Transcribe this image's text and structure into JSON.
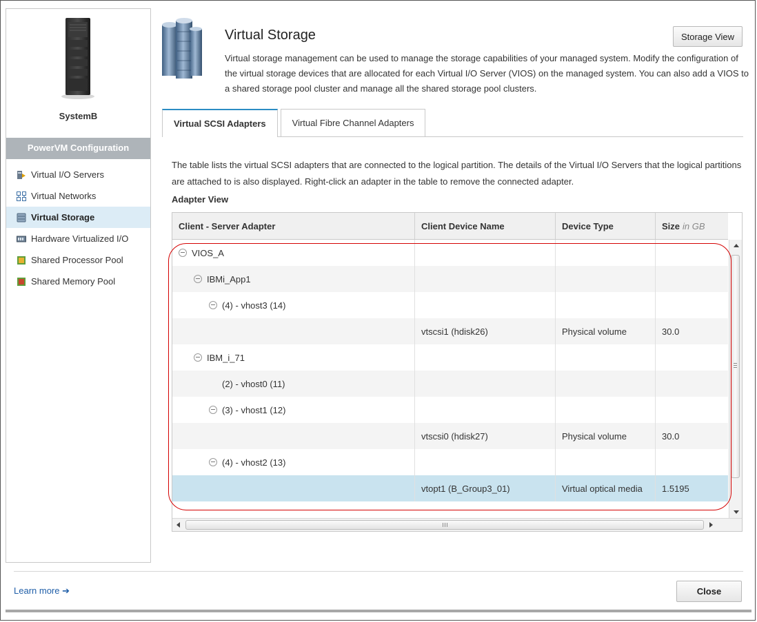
{
  "sidebar": {
    "system_name": "SystemB",
    "section_header": "PowerVM Configuration",
    "items": [
      {
        "label": "Virtual I/O Servers",
        "icon": "vios-icon",
        "active": false
      },
      {
        "label": "Virtual Networks",
        "icon": "network-icon",
        "active": false
      },
      {
        "label": "Virtual Storage",
        "icon": "storage-icon",
        "active": true
      },
      {
        "label": "Hardware Virtualized I/O",
        "icon": "hardware-io-icon",
        "active": false
      },
      {
        "label": "Shared Processor Pool",
        "icon": "processor-pool-icon",
        "active": false
      },
      {
        "label": "Shared Memory Pool",
        "icon": "memory-pool-icon",
        "active": false
      }
    ]
  },
  "header": {
    "title": "Virtual Storage",
    "storage_view_label": "Storage View",
    "description": "Virtual storage management can be used to manage the storage capabilities of your managed system. Modify the configuration of the virtual storage devices that are allocated for each Virtual I/O Server (VIOS) on the managed system. You can also add a VIOS to a shared storage pool cluster and manage all the shared storage pool clusters."
  },
  "tabs": [
    {
      "label": "Virtual SCSI Adapters",
      "active": true
    },
    {
      "label": "Virtual Fibre Channel Adapters",
      "active": false
    }
  ],
  "table": {
    "description": "The table lists the virtual SCSI adapters that are connected to the logical partition. The details of the Virtual I/O Servers that the logical partitions are attached to is also displayed. Right-click an adapter in the table to remove the connected adapter.",
    "section_label": "Adapter View",
    "columns": {
      "adapter": "Client - Server Adapter",
      "device_name": "Client Device Name",
      "device_type": "Device Type",
      "size": "Size",
      "size_unit": "in GB"
    },
    "rows": [
      {
        "adapter": "VIOS_A",
        "level": 0,
        "expander": true,
        "device_name": "",
        "device_type": "",
        "size": "",
        "selected": false
      },
      {
        "adapter": "IBMi_App1",
        "level": 1,
        "expander": true,
        "device_name": "",
        "device_type": "",
        "size": "",
        "selected": false
      },
      {
        "adapter": "(4) - vhost3 (14)",
        "level": 2,
        "expander": true,
        "device_name": "",
        "device_type": "",
        "size": "",
        "selected": false
      },
      {
        "adapter": "",
        "level": 3,
        "expander": false,
        "device_name": "vtscsi1 (hdisk26)",
        "device_type": "Physical volume",
        "size": "30.0",
        "selected": false
      },
      {
        "adapter": "IBM_i_71",
        "level": 1,
        "expander": true,
        "device_name": "",
        "device_type": "",
        "size": "",
        "selected": false
      },
      {
        "adapter": "(2) - vhost0 (11)",
        "level": 2,
        "expander": false,
        "device_name": "",
        "device_type": "",
        "size": "",
        "selected": false
      },
      {
        "adapter": "(3) - vhost1 (12)",
        "level": 2,
        "expander": true,
        "device_name": "",
        "device_type": "",
        "size": "",
        "selected": false
      },
      {
        "adapter": "",
        "level": 3,
        "expander": false,
        "device_name": "vtscsi0 (hdisk27)",
        "device_type": "Physical volume",
        "size": "30.0",
        "selected": false
      },
      {
        "adapter": "(4) - vhost2 (13)",
        "level": 2,
        "expander": true,
        "device_name": "",
        "device_type": "",
        "size": "",
        "selected": false
      },
      {
        "adapter": "",
        "level": 3,
        "expander": false,
        "device_name": "vtopt1 (B_Group3_01)",
        "device_type": "Virtual optical media",
        "size": "1.5195",
        "selected": true
      }
    ]
  },
  "footer": {
    "learn_more": "Learn more",
    "learn_more_arrow": "➔",
    "close_label": "Close"
  },
  "colors": {
    "accent": "#2b8cc4",
    "selected_row": "#c9e3ef",
    "active_nav": "#dcecf6",
    "nav_header": "#aeb4b9",
    "highlight_outline": "#d40000",
    "link": "#1f5ea8"
  }
}
